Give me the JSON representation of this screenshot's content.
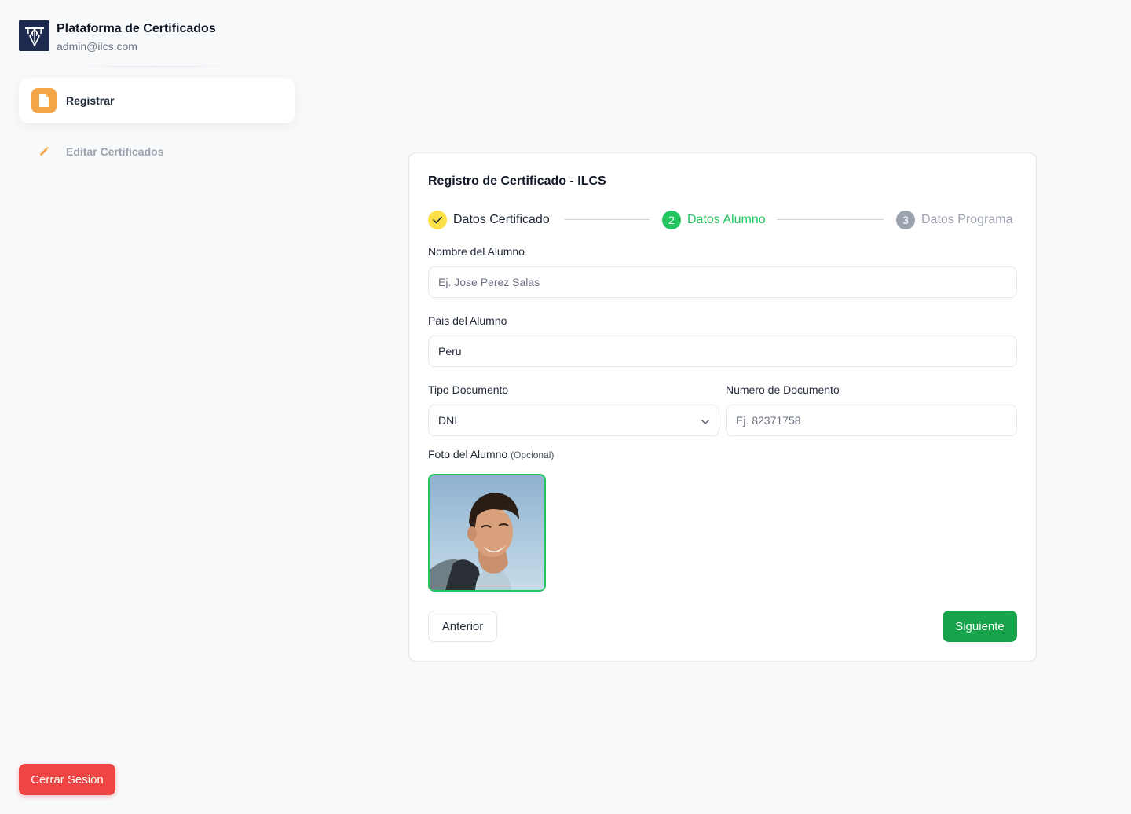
{
  "brand": {
    "title": "Plataforma de Certificados",
    "email": "admin@ilcs.com",
    "logo_icon": "pen-nib-icon",
    "logo_color": "#1b2a4e"
  },
  "sidebar": {
    "items": [
      {
        "label": "Registrar",
        "icon": "document-icon",
        "active": true
      },
      {
        "label": "Editar Certificados",
        "icon": "pencil-icon",
        "active": false
      }
    ],
    "logout_label": "Cerrar Sesion"
  },
  "form": {
    "title": "Registro de Certificado - ILCS",
    "steps": [
      {
        "number": "1",
        "label": "Datos Certificado",
        "status": "completed"
      },
      {
        "number": "2",
        "label": "Datos Alumno",
        "status": "active"
      },
      {
        "number": "3",
        "label": "Datos Programa",
        "status": "pending"
      }
    ],
    "fields": {
      "nombre": {
        "label": "Nombre del Alumno",
        "value": "",
        "placeholder": "Ej. Jose Perez Salas"
      },
      "pais": {
        "label": "Pais del Alumno",
        "value": "Peru",
        "placeholder": ""
      },
      "tipo_documento": {
        "label": "Tipo Documento",
        "selected": "DNI"
      },
      "numero_documento": {
        "label": "Numero de Documento",
        "value": "",
        "placeholder": "Ej. 82371758"
      },
      "foto": {
        "label": "Foto del Alumno",
        "optional_label": "(Opcional)"
      }
    },
    "buttons": {
      "prev": "Anterior",
      "next": "Siguiente"
    }
  },
  "colors": {
    "accent_green": "#22c55e",
    "next_button": "#16a34a",
    "logout_red": "#ef4444",
    "nav_icon_orange": "#f4a545",
    "step_done_yellow": "#fde047"
  }
}
